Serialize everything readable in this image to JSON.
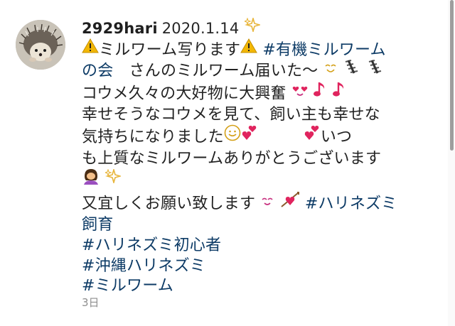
{
  "comment": {
    "username": "2929hari",
    "date": "2020.1.14",
    "icons": [
      "sparkles-icon",
      "warning-icon",
      "smile-icon",
      "caterpillar-icon",
      "heart-eyes-icon",
      "music-note-icon",
      "slightly-smiling-icon",
      "double-heart-icon",
      "bowing-woman-icon",
      "blush-icon",
      "heart-arrow-icon"
    ],
    "l1_text": "ミルワーム写ります",
    "l1_tag": "#有機ミルワーム",
    "l2_tag": "の会",
    "l2_text": "　さんのミルワーム届いた〜",
    "l3_text": "コウメ久々の大好物に大興奮",
    "l4_text": "幸せそうなコウメを見て、飼い主も幸せな",
    "l5_text": "気持ちになりました",
    "l5_tail": "いつ",
    "l6_text": "も上質なミルワームありがとうございます",
    "l8_text": "又宜しくお願い致します",
    "l8_tag": "#ハリネズミ",
    "l9_tag": "飼育",
    "l10_tag": "#ハリネズミ初心者",
    "l11_tag": "#沖縄ハリネズミ",
    "l12_tag": "#ミルワーム"
  },
  "timestamp": "3日",
  "colors": {
    "hashtag": "#0d3b66",
    "timestamp": "#8e8e8e",
    "heart": "#e0245e",
    "warning": "#f2b705",
    "sparkle": "#e8b53a"
  }
}
